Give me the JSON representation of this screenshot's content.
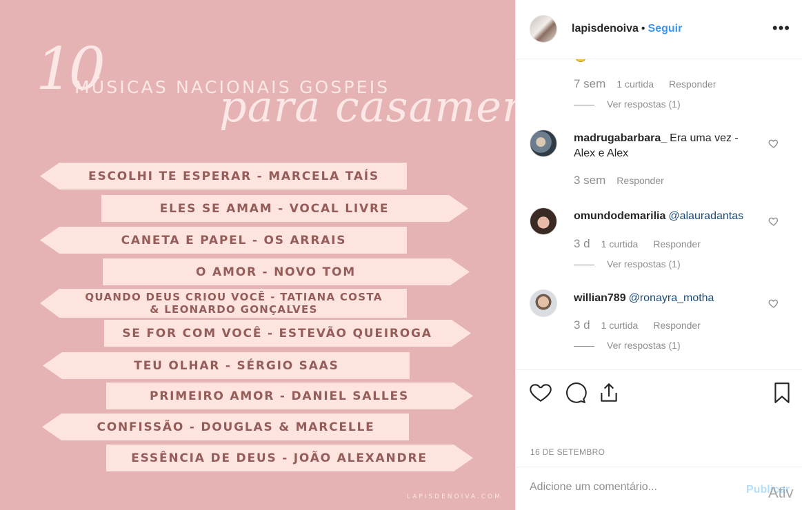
{
  "image": {
    "title_number": "10",
    "title_main": "MÚSICAS NACIONAIS GOSPEIS",
    "title_script": "para casamento",
    "songs": [
      {
        "label": "ESCOLHI TE ESPERAR - MARCELA TAÍS"
      },
      {
        "label": "ELES SE AMAM - VOCAL LIVRE"
      },
      {
        "label": "CANETA E PAPEL - OS ARRAIS"
      },
      {
        "label": "O AMOR - NOVO TOM"
      },
      {
        "line1": "QUANDO DEUS CRIOU VOCÊ - TATIANA COSTA",
        "line2": "& LEONARDO GONÇALVES"
      },
      {
        "label": "SE FOR COM VOCÊ - ESTEVÃO QUEIROGA"
      },
      {
        "label": "TEU OLHAR - SÉRGIO SAAS"
      },
      {
        "label": "PRIMEIRO AMOR - DANIEL SALLES"
      },
      {
        "label": "CONFISSÃO - DOUGLAS & MARCELLE"
      },
      {
        "label": "ESSÊNCIA DE DEUS - JOÃO ALEXANDRE"
      }
    ],
    "watermark": "LAPISDENOIVA.COM",
    "background_color": "#e5b3b3",
    "sign_color": "#fde4df",
    "text_color": "#955d5a"
  },
  "header": {
    "username": "lapisdenoiva",
    "separator": "•",
    "follow_label": "Seguir",
    "more_label": "•••"
  },
  "comments": {
    "partial": {
      "time": "7 sem",
      "likes": "1 curtida",
      "reply": "Responder",
      "view_replies": "Ver respostas (1)"
    },
    "items": [
      {
        "user": "madrugabarbara_",
        "text": "Era uma vez - Alex e Alex",
        "mention": "",
        "time": "3 sem",
        "likes": "",
        "reply": "Responder",
        "view_replies": ""
      },
      {
        "user": "omundodemarilia",
        "text": "",
        "mention": "@alauradantas",
        "time": "3 d",
        "likes": "1 curtida",
        "reply": "Responder",
        "view_replies": "Ver respostas (1)"
      },
      {
        "user": "willian789",
        "text": "",
        "mention": "@ronayra_motha",
        "time": "3 d",
        "likes": "1 curtida",
        "reply": "Responder",
        "view_replies": "Ver respostas (1)"
      }
    ]
  },
  "actions": {
    "icons": [
      "heart-icon",
      "comment-icon",
      "share-icon",
      "bookmark-icon"
    ],
    "date": "16 DE SETEMBRO"
  },
  "add_comment": {
    "placeholder": "Adicione um comentário...",
    "publish_label": "Publicar",
    "overlay_text": "Ativ"
  },
  "colors": {
    "accent": "#3897f0",
    "muted": "#8e8e8e",
    "publish_disabled": "#b2dffc"
  }
}
